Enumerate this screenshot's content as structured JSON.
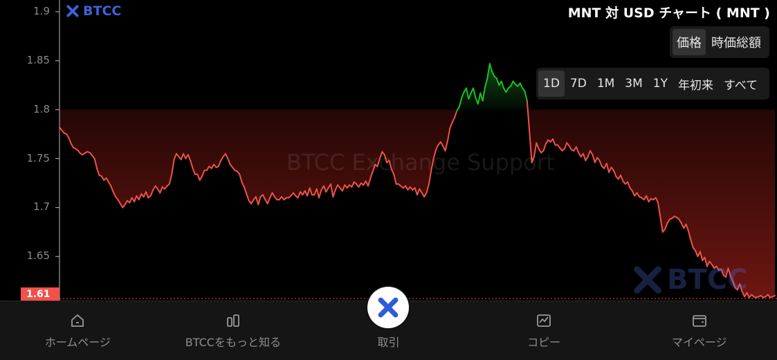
{
  "brand": {
    "name": "BTCC",
    "logo_color": "#3d62d8"
  },
  "chart_title": "MNT 対 USD チャート ( MNT )",
  "view_toggle": {
    "options": [
      "価格",
      "時価総額"
    ],
    "selected": "価格"
  },
  "time_ranges": {
    "options": [
      "1D",
      "7D",
      "1M",
      "3M",
      "1Y",
      "年初来",
      "すべて"
    ],
    "selected": "1D"
  },
  "watermark": {
    "text": "BTCC Exchange Support",
    "logo_text": "BTCC"
  },
  "current_price_label": "1.61",
  "colors": {
    "down_line": "#f0524a",
    "up_line": "#19c226",
    "badge": "#f0524a",
    "background": "#000000",
    "nav_bg": "#151515"
  },
  "bottom_nav": [
    {
      "label": "ホームページ",
      "icon": "home-icon"
    },
    {
      "label": "BTCCをもっと知る",
      "icon": "learn-icon"
    },
    {
      "label": "取引",
      "icon": "trade-icon"
    },
    {
      "label": "コピー",
      "icon": "copy-trading-icon"
    },
    {
      "label": "マイページ",
      "icon": "wallet-icon"
    }
  ],
  "chart_data": {
    "type": "area",
    "title": "MNT 対 USD チャート ( MNT )",
    "y_ticks": [
      "1.9",
      "1.85",
      "1.8",
      "1.75",
      "1.7",
      "1.65",
      "1.61"
    ],
    "ylim": [
      1.605,
      1.912
    ],
    "baseline": 1.8,
    "x_count": 230,
    "grid": false,
    "series": [
      {
        "values": [
          1.782,
          1.779,
          1.776,
          1.775,
          1.771,
          1.765,
          1.761,
          1.76,
          1.758,
          1.755,
          1.754,
          1.756,
          1.757,
          1.756,
          1.753,
          1.75,
          1.74,
          1.733,
          1.732,
          1.728,
          1.73,
          1.726,
          1.722,
          1.716,
          1.711,
          1.708,
          1.704,
          1.7,
          1.703,
          1.707,
          1.705,
          1.71,
          1.706,
          1.712,
          1.708,
          1.714,
          1.711,
          1.716,
          1.71,
          1.712,
          1.718,
          1.722,
          1.719,
          1.715,
          1.721,
          1.719,
          1.722,
          1.724,
          1.734,
          1.749,
          1.755,
          1.752,
          1.749,
          1.755,
          1.75,
          1.754,
          1.748,
          1.74,
          1.734,
          1.734,
          1.728,
          1.732,
          1.738,
          1.738,
          1.742,
          1.74,
          1.744,
          1.741,
          1.742,
          1.748,
          1.752,
          1.755,
          1.75,
          1.744,
          1.741,
          1.738,
          1.737,
          1.734,
          1.726,
          1.721,
          1.714,
          1.707,
          1.704,
          1.708,
          1.711,
          1.703,
          1.711,
          1.713,
          1.708,
          1.704,
          1.71,
          1.715,
          1.711,
          1.708,
          1.708,
          1.711,
          1.708,
          1.71,
          1.71,
          1.712,
          1.715,
          1.712,
          1.71,
          1.716,
          1.713,
          1.717,
          1.712,
          1.72,
          1.713,
          1.713,
          1.719,
          1.71,
          1.718,
          1.722,
          1.716,
          1.72,
          1.724,
          1.711,
          1.718,
          1.723,
          1.72,
          1.717,
          1.723,
          1.72,
          1.723,
          1.721,
          1.726,
          1.724,
          1.721,
          1.725,
          1.723,
          1.727,
          1.722,
          1.73,
          1.737,
          1.744,
          1.742,
          1.75,
          1.757,
          1.754,
          1.746,
          1.748,
          1.739,
          1.734,
          1.724,
          1.724,
          1.722,
          1.72,
          1.722,
          1.718,
          1.721,
          1.718,
          1.72,
          1.713,
          1.719,
          1.715,
          1.711,
          1.715,
          1.724,
          1.738,
          1.75,
          1.759,
          1.764,
          1.767,
          1.763,
          1.758,
          1.768,
          1.781,
          1.787,
          1.792,
          1.799,
          1.803,
          1.812,
          1.818,
          1.822,
          1.811,
          1.817,
          1.822,
          1.812,
          1.806,
          1.817,
          1.809,
          1.823,
          1.832,
          1.847,
          1.839,
          1.834,
          1.832,
          1.825,
          1.829,
          1.822,
          1.818,
          1.822,
          1.824,
          1.829,
          1.826,
          1.824,
          1.827,
          1.822,
          1.819,
          1.809,
          1.778,
          1.746,
          1.752,
          1.766,
          1.76,
          1.756,
          1.758,
          1.765,
          1.769,
          1.767,
          1.77,
          1.764,
          1.764,
          1.761,
          1.758,
          1.76,
          1.766,
          1.763,
          1.759,
          1.758,
          1.762,
          1.756,
          1.752,
          1.755
        ],
        "values_tail": [
          1.748,
          1.752,
          1.758,
          1.754,
          1.746,
          1.751,
          1.748,
          1.742,
          1.74,
          1.745,
          1.736,
          1.741,
          1.738,
          1.732,
          1.729,
          1.733,
          1.727,
          1.724,
          1.726,
          1.72,
          1.717,
          1.712,
          1.715,
          1.711,
          1.71,
          1.708,
          1.712,
          1.706,
          1.709,
          1.708,
          1.71,
          1.705,
          1.69,
          1.675,
          1.678,
          1.684,
          1.688,
          1.689,
          1.691,
          1.69,
          1.688,
          1.684,
          1.679,
          1.683,
          1.676,
          1.667,
          1.659,
          1.656,
          1.65,
          1.655,
          1.646,
          1.649,
          1.64,
          1.645,
          1.642,
          1.638,
          1.64,
          1.636,
          1.637,
          1.631,
          1.629,
          1.638,
          1.63,
          1.624,
          1.618,
          1.616,
          1.622,
          1.614,
          1.609,
          1.613,
          1.608,
          1.611,
          1.609,
          1.608,
          1.609,
          1.61,
          1.608,
          1.609,
          1.611,
          1.608,
          1.609,
          1.61
        ]
      }
    ]
  }
}
